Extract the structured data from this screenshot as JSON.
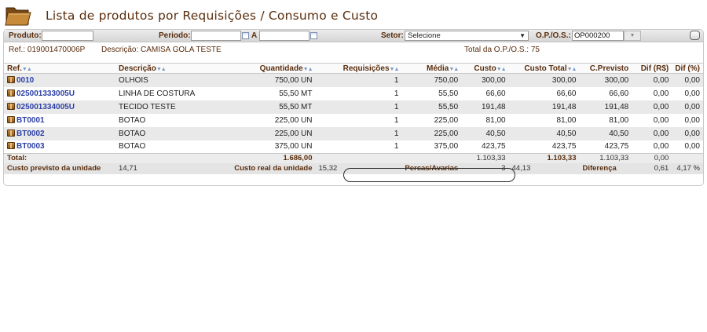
{
  "page": {
    "title": "Lista de produtos por Requisições / Consumo e Custo"
  },
  "filters": {
    "produto_label": "Produto:",
    "produto_value": "",
    "periodo_label": "Periodo:",
    "periodo_from": "",
    "periodo_to_label": "A",
    "periodo_to": "",
    "setor_label": "Setor:",
    "setor_value": "Selecione",
    "op_label": "O.P./O.S.:",
    "op_value": "OP000200"
  },
  "info": {
    "ref": "Ref.: 019001470006P",
    "descricao": "Descrição: CAMISA GOLA TESTE",
    "total_op": "Total da O.P./O.S.:  75"
  },
  "table": {
    "columns": [
      "Ref.",
      "Descrição",
      "Quantidade",
      "Requisições",
      "Média",
      "Custo",
      "Custo Total",
      "C.Previsto",
      "Dif (R$)",
      "Dif (%)"
    ],
    "rows": [
      {
        "ref": "0010",
        "desc": "OLHOIS",
        "qtd": "750,00 UN",
        "req": "1",
        "media": "750,00",
        "custo": "300,00",
        "custo_total": "300,00",
        "previsto": "300,00",
        "dif_rs": "0,00",
        "dif_pct": "0,00"
      },
      {
        "ref": "025001333005U",
        "desc": "LINHA DE COSTURA",
        "qtd": "55,50 MT",
        "req": "1",
        "media": "55,50",
        "custo": "66,60",
        "custo_total": "66,60",
        "previsto": "66,60",
        "dif_rs": "0,00",
        "dif_pct": "0,00"
      },
      {
        "ref": "025001334005U",
        "desc": "TECIDO TESTE",
        "qtd": "55,50 MT",
        "req": "1",
        "media": "55,50",
        "custo": "191,48",
        "custo_total": "191,48",
        "previsto": "191,48",
        "dif_rs": "0,00",
        "dif_pct": "0,00"
      },
      {
        "ref": "BT0001",
        "desc": "BOTAO",
        "qtd": "225,00 UN",
        "req": "1",
        "media": "225,00",
        "custo": "81,00",
        "custo_total": "81,00",
        "previsto": "81,00",
        "dif_rs": "0,00",
        "dif_pct": "0,00"
      },
      {
        "ref": "BT0002",
        "desc": "BOTAO",
        "qtd": "225,00 UN",
        "req": "1",
        "media": "225,00",
        "custo": "40,50",
        "custo_total": "40,50",
        "previsto": "40,50",
        "dif_rs": "0,00",
        "dif_pct": "0,00"
      },
      {
        "ref": "BT0003",
        "desc": "BOTAO",
        "qtd": "375,00 UN",
        "req": "1",
        "media": "375,00",
        "custo": "423,75",
        "custo_total": "423,75",
        "previsto": "423,75",
        "dif_rs": "0,00",
        "dif_pct": "0,00"
      }
    ],
    "total": {
      "label": "Total:",
      "qtd": "1.686,00",
      "custo": "1.103,33",
      "custo_total": "1.103,33",
      "previsto": "1.103,33",
      "dif_rs": "0,00"
    },
    "summary": {
      "previsto_label": "Custo previsto da unidade",
      "previsto_value": "14,71",
      "real_label": "Custo real da unidade",
      "real_value": "15,32",
      "perdas_label": "Percas/Avarias",
      "perdas_qtd": "3",
      "perdas_value": "44,13",
      "diferenca_label": "Diferença",
      "diferenca_value": "0,61",
      "diferenca_pct": "4,17 %"
    }
  },
  "colors": {
    "title": "#5a2d0c",
    "link": "#2b3fa6",
    "row_alt": "#e9e9e9"
  }
}
